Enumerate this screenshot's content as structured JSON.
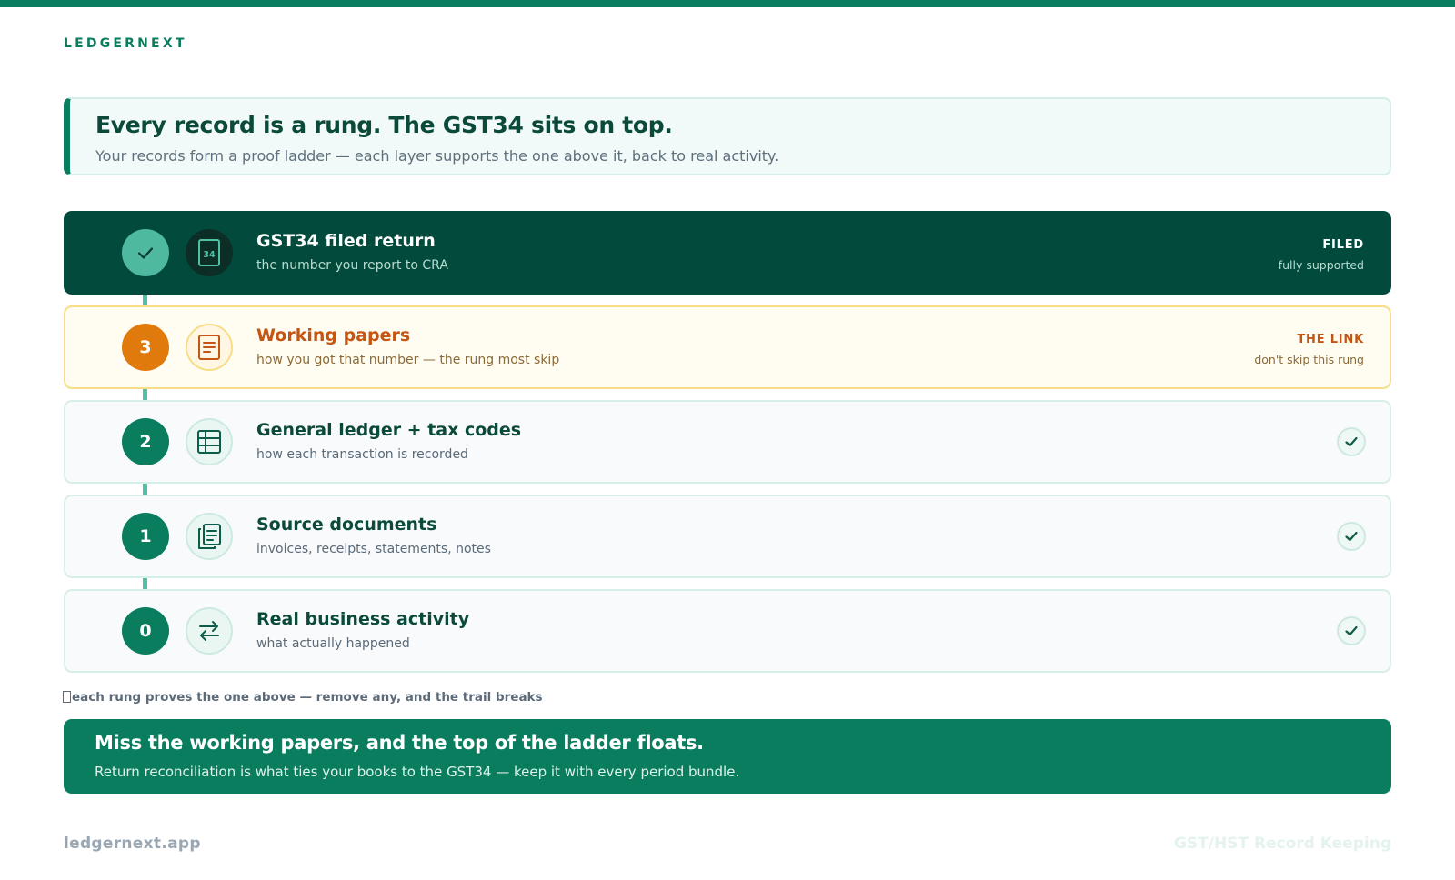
{
  "brand": "LEDGERNEXT",
  "headline": {
    "title": "Every record is a rung. The GST34 sits on top.",
    "subtitle": "Your records form a proof ladder — each layer supports the one above it, back to real activity."
  },
  "ladder": [
    {
      "marker": "check",
      "icon": "form-34-icon",
      "icon_text": "34",
      "title": "GST34 filed return",
      "subtitle": "the number you report to CRA",
      "status_label": "FILED",
      "status_note": "fully supported"
    },
    {
      "marker": "3",
      "icon": "document-icon",
      "title": "Working papers",
      "subtitle": "how you got that number — the rung most skip",
      "status_label": "THE LINK",
      "status_note": "don't skip this rung"
    },
    {
      "marker": "2",
      "icon": "table-grid-icon",
      "title": "General ledger + tax codes",
      "subtitle": "how each transaction is recorded",
      "status": "check"
    },
    {
      "marker": "1",
      "icon": "documents-stack-icon",
      "title": "Source documents",
      "subtitle": "invoices, receipts, statements, notes",
      "status": "check"
    },
    {
      "marker": "0",
      "icon": "exchange-arrows-icon",
      "title": "Real business activity",
      "subtitle": "what actually happened",
      "status": "check"
    }
  ],
  "footnote": "each rung proves the one above — remove any, and the trail breaks",
  "callout": {
    "title": "Miss the working papers, and the top of the ladder floats.",
    "body": "Return reconciliation is what ties your books to the GST34 — keep it with every period bundle."
  },
  "footer": {
    "site": "ledgernext.app",
    "tagline": "GST/HST Record Keeping"
  },
  "colors": {
    "brand_green": "#0a7d5e",
    "dark_green": "#014a3c",
    "link_orange": "#e17a0d",
    "link_border": "#f6de86"
  }
}
